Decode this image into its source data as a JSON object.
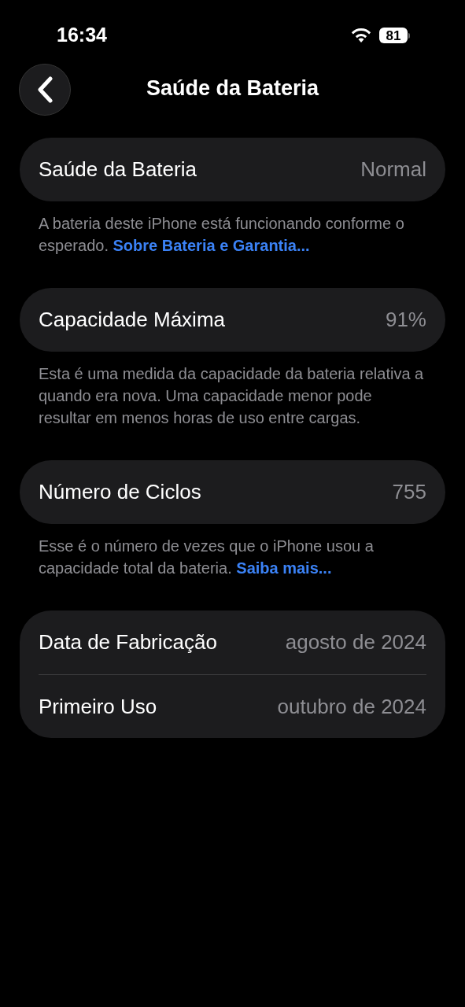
{
  "status_bar": {
    "time": "16:34",
    "battery": "81"
  },
  "nav": {
    "title": "Saúde da Bateria"
  },
  "sections": [
    {
      "rows": [
        {
          "label": "Saúde da Bateria",
          "value": "Normal"
        }
      ],
      "footer": {
        "text": "A bateria deste iPhone está funcionando conforme o esperado.",
        "link": "Sobre Bateria e Garantia..."
      }
    },
    {
      "rows": [
        {
          "label": "Capacidade Máxima",
          "value": "91%"
        }
      ],
      "footer": {
        "text": "Esta é uma medida da capacidade da bateria relativa a quando era nova. Uma capacidade menor pode resultar em menos horas de uso entre cargas."
      }
    },
    {
      "rows": [
        {
          "label": "Número de Ciclos",
          "value": "755"
        }
      ],
      "footer": {
        "text": "Esse é o número de vezes que o iPhone usou a capacidade total da bateria.",
        "link": "Saiba mais..."
      }
    },
    {
      "rows": [
        {
          "label": "Data de Fabricação",
          "value": "agosto de 2024"
        },
        {
          "label": "Primeiro Uso",
          "value": "outubro de 2024"
        }
      ]
    }
  ]
}
